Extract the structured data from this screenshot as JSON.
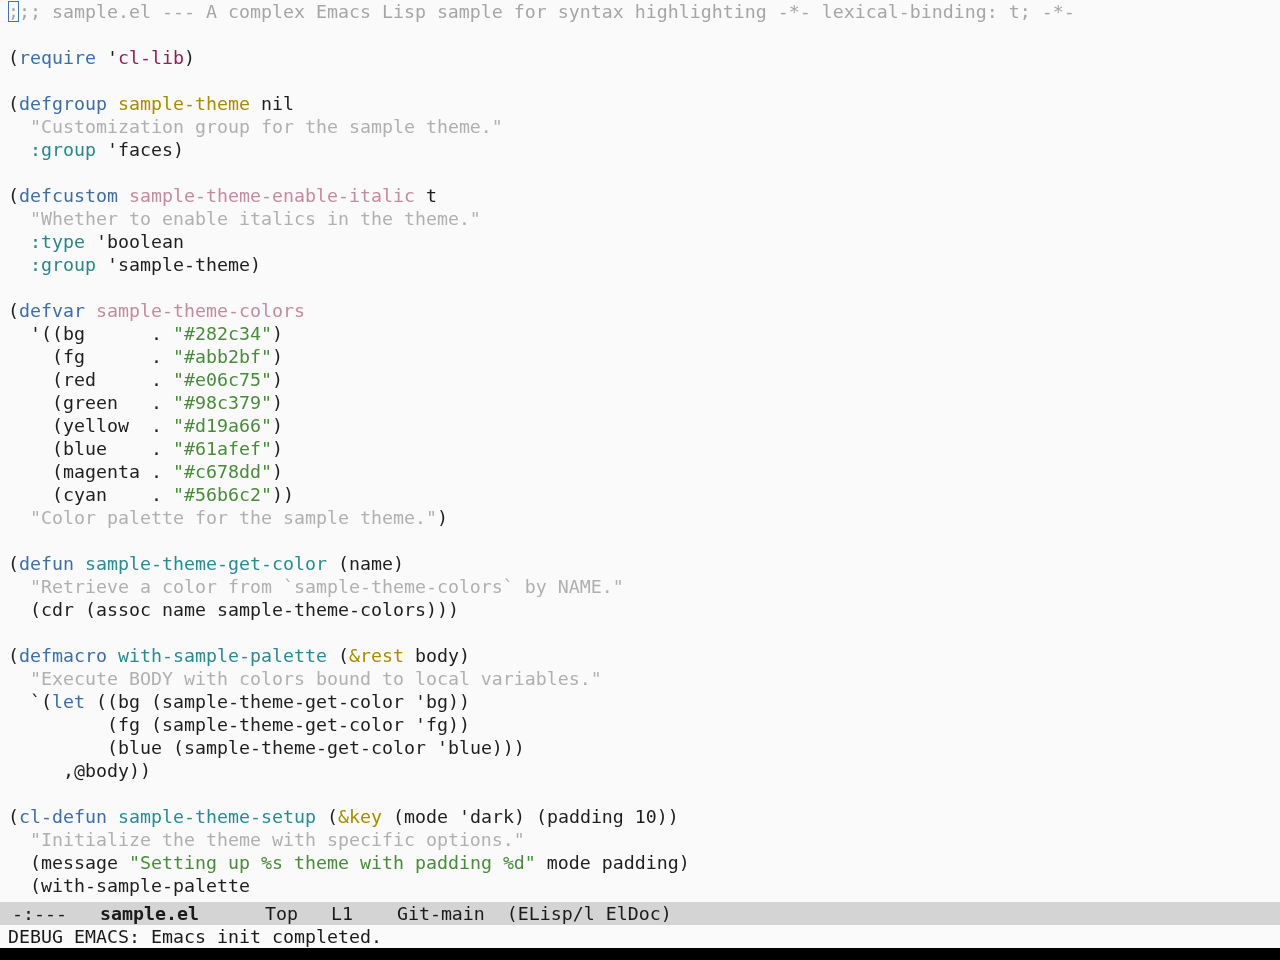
{
  "buffer": {
    "lines": [
      {
        "cursor": true,
        "tokens": [
          {
            "kind": "comment",
            "text": ";;; sample.el --- A complex Emacs Lisp sample for syntax highlighting -*- lexical-binding: t; -*-"
          }
        ]
      },
      {
        "cursor": false
      },
      {
        "cursor": false,
        "tokens": [
          {
            "kind": "plain",
            "text": "("
          },
          {
            "kind": "keyword",
            "text": "require"
          },
          {
            "kind": "plain",
            "text": " '"
          },
          {
            "kind": "constant",
            "text": "cl-lib"
          },
          {
            "kind": "plain",
            "text": ")"
          }
        ]
      },
      {
        "cursor": false
      },
      {
        "cursor": false,
        "tokens": [
          {
            "kind": "plain",
            "text": "("
          },
          {
            "kind": "keyword",
            "text": "defgroup"
          },
          {
            "kind": "type",
            "text": " sample-theme"
          },
          {
            "kind": "plain",
            "text": " nil"
          }
        ]
      },
      {
        "cursor": false,
        "tokens": [
          {
            "kind": "doc",
            "text": "  \"Customization group for the sample theme.\""
          }
        ]
      },
      {
        "cursor": false,
        "tokens": [
          {
            "kind": "builtin",
            "text": "  :group"
          },
          {
            "kind": "plain",
            "text": " 'faces)"
          }
        ]
      },
      {
        "cursor": false
      },
      {
        "cursor": false,
        "tokens": [
          {
            "kind": "plain",
            "text": "("
          },
          {
            "kind": "keyword",
            "text": "defcustom"
          },
          {
            "kind": "variable",
            "text": " sample-theme-enable-italic"
          },
          {
            "kind": "plain",
            "text": " t"
          }
        ]
      },
      {
        "cursor": false,
        "tokens": [
          {
            "kind": "doc",
            "text": "  \"Whether to enable italics in the theme.\""
          }
        ]
      },
      {
        "cursor": false,
        "tokens": [
          {
            "kind": "builtin",
            "text": "  :type"
          },
          {
            "kind": "plain",
            "text": " 'boolean"
          }
        ]
      },
      {
        "cursor": false,
        "tokens": [
          {
            "kind": "builtin",
            "text": "  :group"
          },
          {
            "kind": "plain",
            "text": " 'sample-theme)"
          }
        ]
      },
      {
        "cursor": false
      },
      {
        "cursor": false,
        "tokens": [
          {
            "kind": "plain",
            "text": "("
          },
          {
            "kind": "keyword",
            "text": "defvar"
          },
          {
            "kind": "variable",
            "text": " sample-theme-colors"
          }
        ]
      },
      {
        "cursor": false,
        "tokens": [
          {
            "kind": "plain",
            "text": "  '((bg      . "
          },
          {
            "kind": "string",
            "text": "\"#282c34\""
          },
          {
            "kind": "plain",
            "text": ")"
          }
        ]
      },
      {
        "cursor": false,
        "tokens": [
          {
            "kind": "plain",
            "text": "    (fg      . "
          },
          {
            "kind": "string",
            "text": "\"#abb2bf\""
          },
          {
            "kind": "plain",
            "text": ")"
          }
        ]
      },
      {
        "cursor": false,
        "tokens": [
          {
            "kind": "plain",
            "text": "    (red     . "
          },
          {
            "kind": "string",
            "text": "\"#e06c75\""
          },
          {
            "kind": "plain",
            "text": ")"
          }
        ]
      },
      {
        "cursor": false,
        "tokens": [
          {
            "kind": "plain",
            "text": "    (green   . "
          },
          {
            "kind": "string",
            "text": "\"#98c379\""
          },
          {
            "kind": "plain",
            "text": ")"
          }
        ]
      },
      {
        "cursor": false,
        "tokens": [
          {
            "kind": "plain",
            "text": "    (yellow  . "
          },
          {
            "kind": "string",
            "text": "\"#d19a66\""
          },
          {
            "kind": "plain",
            "text": ")"
          }
        ]
      },
      {
        "cursor": false,
        "tokens": [
          {
            "kind": "plain",
            "text": "    (blue    . "
          },
          {
            "kind": "string",
            "text": "\"#61afef\""
          },
          {
            "kind": "plain",
            "text": ")"
          }
        ]
      },
      {
        "cursor": false,
        "tokens": [
          {
            "kind": "plain",
            "text": "    (magenta . "
          },
          {
            "kind": "string",
            "text": "\"#c678dd\""
          },
          {
            "kind": "plain",
            "text": ")"
          }
        ]
      },
      {
        "cursor": false,
        "tokens": [
          {
            "kind": "plain",
            "text": "    (cyan    . "
          },
          {
            "kind": "string",
            "text": "\"#56b6c2\""
          },
          {
            "kind": "plain",
            "text": "))"
          }
        ]
      },
      {
        "cursor": false,
        "tokens": [
          {
            "kind": "doc",
            "text": "  \"Color palette for the sample theme.\""
          },
          {
            "kind": "plain",
            "text": ")"
          }
        ]
      },
      {
        "cursor": false
      },
      {
        "cursor": false,
        "tokens": [
          {
            "kind": "plain",
            "text": "("
          },
          {
            "kind": "keyword",
            "text": "defun"
          },
          {
            "kind": "function",
            "text": " sample-theme-get-color"
          },
          {
            "kind": "plain",
            "text": " (name)"
          }
        ]
      },
      {
        "cursor": false,
        "tokens": [
          {
            "kind": "doc",
            "text": "  \"Retrieve a color from `sample-theme-colors` by NAME.\""
          }
        ]
      },
      {
        "cursor": false,
        "tokens": [
          {
            "kind": "plain",
            "text": "  (cdr (assoc name sample-theme-colors)))"
          }
        ]
      },
      {
        "cursor": false
      },
      {
        "cursor": false,
        "tokens": [
          {
            "kind": "plain",
            "text": "("
          },
          {
            "kind": "keyword",
            "text": "defmacro"
          },
          {
            "kind": "function",
            "text": " with-sample-palette"
          },
          {
            "kind": "plain",
            "text": " ("
          },
          {
            "kind": "type",
            "text": "&rest"
          },
          {
            "kind": "plain",
            "text": " body)"
          }
        ]
      },
      {
        "cursor": false,
        "tokens": [
          {
            "kind": "doc",
            "text": "  \"Execute BODY with colors bound to local variables.\""
          }
        ]
      },
      {
        "cursor": false,
        "tokens": [
          {
            "kind": "plain",
            "text": "  `("
          },
          {
            "kind": "keyword",
            "text": "let"
          },
          {
            "kind": "plain",
            "text": " ((bg (sample-theme-get-color 'bg))"
          }
        ]
      },
      {
        "cursor": false,
        "tokens": [
          {
            "kind": "plain",
            "text": "         (fg (sample-theme-get-color 'fg))"
          }
        ]
      },
      {
        "cursor": false,
        "tokens": [
          {
            "kind": "plain",
            "text": "         (blue (sample-theme-get-color 'blue)))"
          }
        ]
      },
      {
        "cursor": false,
        "tokens": [
          {
            "kind": "plain",
            "text": "     ,@body))"
          }
        ]
      },
      {
        "cursor": false
      },
      {
        "cursor": false,
        "tokens": [
          {
            "kind": "plain",
            "text": "("
          },
          {
            "kind": "keyword",
            "text": "cl-defun"
          },
          {
            "kind": "function",
            "text": " sample-theme-setup"
          },
          {
            "kind": "plain",
            "text": " ("
          },
          {
            "kind": "type",
            "text": "&key"
          },
          {
            "kind": "plain",
            "text": " (mode 'dark) (padding 10))"
          }
        ]
      },
      {
        "cursor": false,
        "tokens": [
          {
            "kind": "doc",
            "text": "  \"Initialize the theme with specific options.\""
          }
        ]
      },
      {
        "cursor": false,
        "tokens": [
          {
            "kind": "plain",
            "text": "  (message "
          },
          {
            "kind": "string",
            "text": "\"Setting up %s theme with padding %d\""
          },
          {
            "kind": "plain",
            "text": " mode padding)"
          }
        ]
      },
      {
        "cursor": false,
        "tokens": [
          {
            "kind": "plain",
            "text": "  (with-sample-palette"
          }
        ]
      }
    ]
  },
  "mode_line": {
    "status": "-:---",
    "buffer_name": "sample.el",
    "position": "Top",
    "line": "L1",
    "vc_branch": "Git-main",
    "modes": "(ELisp/l ElDoc)"
  },
  "echo_area": {
    "message": "DEBUG EMACS: Emacs init completed."
  }
}
